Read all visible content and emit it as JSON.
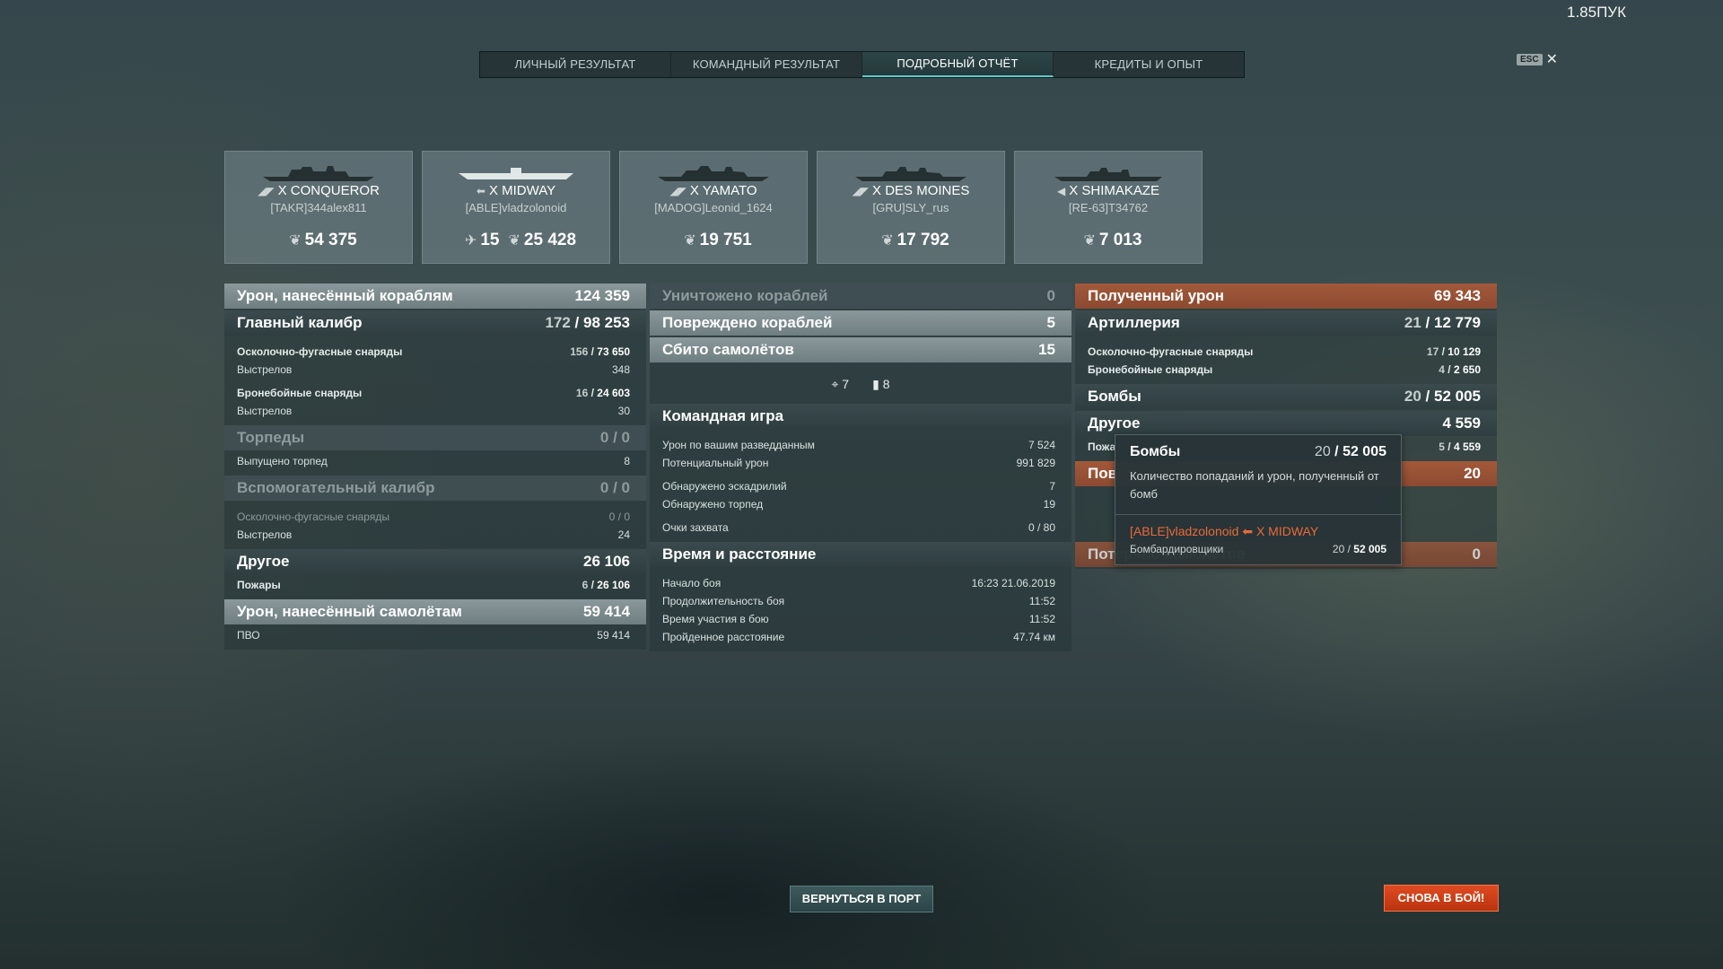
{
  "version_label": "1.85ПУК",
  "esc": {
    "key": "ESC",
    "close": "✕"
  },
  "tabs": [
    {
      "label": "ЛИЧНЫЙ РЕЗУЛЬТАТ"
    },
    {
      "label": "КОМАНДНЫЙ РЕЗУЛЬТАТ"
    },
    {
      "label": "ПОДРОБНЫЙ ОТЧЁТ",
      "active": true
    },
    {
      "label": "КРЕДИТЫ И ОПЫТ"
    }
  ],
  "ships": [
    {
      "type_icon": "◢◤",
      "name": "X CONQUEROR",
      "player": "[TAKR]344alex811",
      "score": "54 375"
    },
    {
      "type_icon": "⬅",
      "name": "X MIDWAY",
      "player": "[ABLE]vladzolonoid",
      "planes": "15",
      "score": "25 428"
    },
    {
      "type_icon": "◢◤",
      "name": "X YAMATO",
      "player": "[MADOG]Leonid_1624",
      "score": "19 751"
    },
    {
      "type_icon": "◢◤",
      "name": "X DES MOINES",
      "player": "[GRU]SLY_rus",
      "score": "17 792"
    },
    {
      "type_icon": "◀",
      "name": "X SHIMAKAZE",
      "player": "[RE-63]T34762",
      "score": "7 013"
    }
  ],
  "left": {
    "damage_ships": {
      "label": "Урон, нанесённый кораблям",
      "value": "124 359"
    },
    "main_battery": {
      "label": "Главный калибр",
      "hits": "172",
      "value": "98 253"
    },
    "he": {
      "label": "Осколочно-фугасные снаряды",
      "hits": "156",
      "value": "73 650"
    },
    "he_shots": {
      "label": "Выстрелов",
      "value": "348"
    },
    "ap": {
      "label": "Бронебойные снаряды",
      "hits": "16",
      "value": "24 603"
    },
    "ap_shots": {
      "label": "Выстрелов",
      "value": "30"
    },
    "torpedoes": {
      "label": "Торпеды",
      "value": "0 / 0"
    },
    "torp_launched": {
      "label": "Выпущено торпед",
      "value": "8"
    },
    "secondary": {
      "label": "Вспомогательный калибр",
      "value": "0 / 0"
    },
    "sec_he": {
      "label": "Осколочно-фугасные снаряды",
      "value": "0 / 0"
    },
    "sec_shots": {
      "label": "Выстрелов",
      "value": "24"
    },
    "other": {
      "label": "Другое",
      "value": "26 106"
    },
    "fires": {
      "label": "Пожары",
      "hits": "6",
      "value": "26 106"
    },
    "damage_planes": {
      "label": "Урон, нанесённый самолётам",
      "value": "59 414"
    },
    "aa": {
      "label": "ПВО",
      "value": "59 414"
    }
  },
  "center": {
    "destroyed": {
      "label": "Уничтожено кораблей",
      "value": "0"
    },
    "damaged": {
      "label": "Повреждено кораблей",
      "value": "5"
    },
    "planes_shot": {
      "label": "Сбито самолётов",
      "value": "15"
    },
    "aa_kills": {
      "icon": "crosshair-icon",
      "value": "7"
    },
    "fighter_kills": {
      "icon": "fighter-icon",
      "value": "8"
    },
    "team": {
      "label": "Командная игра"
    },
    "spotting_damage": {
      "label": "Урон по вашим разведданным",
      "value": "7 524"
    },
    "potential": {
      "label": "Потенциальный урон",
      "value": "991 829"
    },
    "squads": {
      "label": "Обнаружено эскадрилий",
      "value": "7"
    },
    "torps_spotted": {
      "label": "Обнаружено торпед",
      "value": "19"
    },
    "capture": {
      "label": "Очки захвата",
      "value": "0 / 80"
    },
    "time": {
      "label": "Время и расстояние"
    },
    "start": {
      "label": "Начало боя",
      "value": "16:23  21.06.2019"
    },
    "duration": {
      "label": "Продолжительность боя",
      "value": "11:52"
    },
    "participation": {
      "label": "Время участия в бою",
      "value": "11:52"
    },
    "distance": {
      "label": "Пройденное расстояние",
      "value": "47.74 км"
    }
  },
  "right": {
    "received": {
      "label": "Полученный урон",
      "value": "69 343"
    },
    "artillery": {
      "label": "Артиллерия",
      "hits": "21",
      "value": "12 779"
    },
    "he": {
      "label": "Осколочно-фугасные снаряды",
      "hits": "17",
      "value": "10 129"
    },
    "ap": {
      "label": "Бронебойные снаряды",
      "hits": "4",
      "value": "2 650"
    },
    "bombs": {
      "label": "Бомбы",
      "hits": "20",
      "value": "52 005"
    },
    "other": {
      "label": "Другое",
      "value": "4 559"
    },
    "fires": {
      "label": "Пожа",
      "hits": "5",
      "value": "4 559"
    },
    "pov": {
      "label": "Пов",
      "value": "20"
    },
    "planes_lost": {
      "label": "Потеряно самолётов",
      "value": "0"
    }
  },
  "tooltip": {
    "title": "Бомбы",
    "hits": "20",
    "value": "52 005",
    "desc": "Количество попаданий и урон, полученный от бомб",
    "player": "[ABLE]vladzolonoid",
    "ship": "X MIDWAY",
    "source": "Бомбардировщики",
    "src_hits": "20",
    "src_value": "52 005"
  },
  "buttons": {
    "port": "ВЕРНУТЬСЯ В ПОРТ",
    "battle": "СНОВА В БОЙ!"
  }
}
